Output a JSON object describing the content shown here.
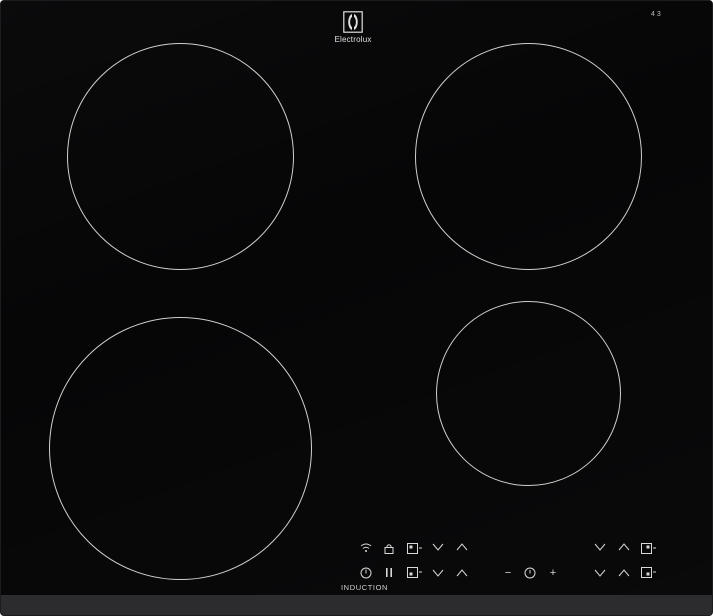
{
  "brand": {
    "name": "Electrolux",
    "corner_label": "4 3"
  },
  "controls": {
    "row1": [
      "wifi-icon",
      "lock-icon",
      "zone-select-icon",
      "chevron-down-icon",
      "chevron-up-icon"
    ],
    "row2": [
      "power-icon",
      "pause-icon",
      "zone-select-icon",
      "chevron-down-icon",
      "chevron-up-icon"
    ],
    "timer": [
      "minus-icon",
      "timer-icon",
      "plus-icon"
    ],
    "right_row1": [
      "chevron-down-icon",
      "chevron-up-icon",
      "zone-select-icon"
    ],
    "right_row2": [
      "chevron-down-icon",
      "chevron-up-icon",
      "zone-select-icon"
    ],
    "minus_symbol": "−",
    "plus_symbol": "+"
  },
  "label": {
    "induction": "INDUCTION"
  },
  "colors": {
    "surface": "#060607",
    "ring": "#cfcfcf",
    "strip": "#2c2c2e"
  }
}
